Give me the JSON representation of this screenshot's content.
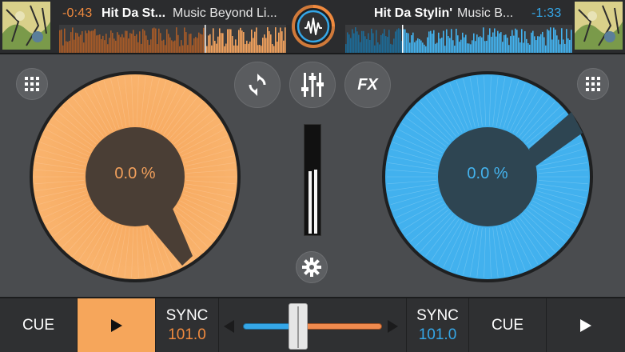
{
  "deck_left": {
    "time_remaining": "-0:43",
    "title": "Hit Da St...",
    "artist": "Music Beyond Li...",
    "pitch_percent": "0.0 %",
    "bpm": "101.0",
    "color": "#f08a3e",
    "cue_label": "CUE",
    "sync_label": "SYNC",
    "playing": true,
    "track_progress": 0.64
  },
  "deck_right": {
    "time_remaining": "-1:33",
    "title": "Hit Da Stylin'",
    "artist": "Music B...",
    "pitch_percent": "0.0 %",
    "bpm": "101.0",
    "color": "#35a7e8",
    "cue_label": "CUE",
    "sync_label": "SYNC",
    "playing": false,
    "track_progress": 0.25
  },
  "center": {
    "sync_icon": "loop-sync-icon",
    "mixer_icon": "eq-sliders-icon",
    "fx_label": "FX",
    "settings_icon": "gear-icon",
    "crossfader_position": 0.38,
    "vu_left": 0.58,
    "vu_right": 0.6
  },
  "icons": {
    "grid": "grid-icon",
    "logo": "waveform-logo-icon",
    "play": "play-icon"
  }
}
